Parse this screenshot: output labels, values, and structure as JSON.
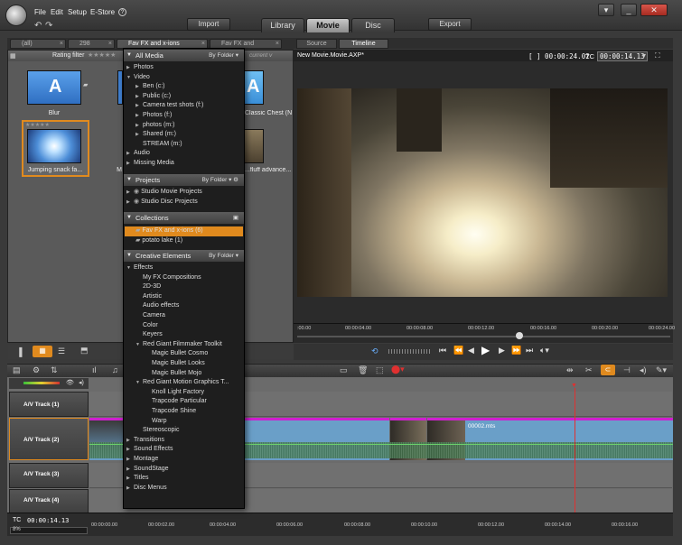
{
  "menu": {
    "file": "File",
    "edit": "Edit",
    "setup": "Setup",
    "estore": "E-Store",
    "help": "?"
  },
  "window": {
    "minimize": "_",
    "close": "✕",
    "menu": "▾"
  },
  "toolbar": {
    "import": "Import",
    "export": "Export"
  },
  "main_tabs": [
    {
      "label": "Library"
    },
    {
      "label": "Movie"
    },
    {
      "label": "Disc"
    }
  ],
  "library_tabs": [
    {
      "label": "(all)"
    },
    {
      "label": "298"
    },
    {
      "label": "Fav FX and x-ions"
    },
    {
      "label": "Fav FX and"
    }
  ],
  "library": {
    "rating_filter": "Rating filter",
    "sort_hint": "current v",
    "thumbs": [
      {
        "label": "Blur",
        "glyph": "A"
      },
      {
        "label": "Jumping snack fa...",
        "glyph": ""
      },
      {
        "label": "M",
        "glyph": ""
      },
      {
        "label": "Classic Chest (No ...",
        "glyph": "A"
      },
      {
        "label": "...fluff advance...",
        "glyph": ""
      }
    ]
  },
  "dropdown": {
    "all_media": {
      "title": "All Media",
      "sort": "By Folder"
    },
    "media_items": [
      {
        "label": "Photos",
        "arrow": "▶",
        "indent": 0
      },
      {
        "label": "Video",
        "arrow": "▼",
        "indent": 0
      },
      {
        "label": "Ben (c:)",
        "arrow": "▶",
        "indent": 1
      },
      {
        "label": "Public (c:)",
        "arrow": "▶",
        "indent": 1
      },
      {
        "label": "Camera test shots (f:)",
        "arrow": "▶",
        "indent": 1
      },
      {
        "label": "Photos (f:)",
        "arrow": "▶",
        "indent": 1
      },
      {
        "label": "photos (m:)",
        "arrow": "▶",
        "indent": 1
      },
      {
        "label": "Shared (m:)",
        "arrow": "▶",
        "indent": 1
      },
      {
        "label": "STREAM (m:)",
        "arrow": "",
        "indent": 1
      },
      {
        "label": "Audio",
        "arrow": "▶",
        "indent": 0
      },
      {
        "label": "Missing Media",
        "arrow": "▶",
        "indent": 0
      }
    ],
    "projects": {
      "title": "Projects",
      "sort": "By Folder"
    },
    "project_items": [
      {
        "label": "Studio Movie Projects",
        "arrow": "▶"
      },
      {
        "label": "Studio Disc Projects",
        "arrow": "▶"
      }
    ],
    "collections": {
      "title": "Collections"
    },
    "collection_items": [
      {
        "label": "Fav FX and x-ions  (6)"
      },
      {
        "label": "potato lake  (1)"
      }
    ],
    "creative": {
      "title": "Creative Elements",
      "sort": "By Folder"
    },
    "creative_items": [
      {
        "label": "Effects",
        "arrow": "▼",
        "indent": 0
      },
      {
        "label": "My FX Compositions",
        "arrow": "",
        "indent": 1
      },
      {
        "label": "2D-3D",
        "arrow": "",
        "indent": 1
      },
      {
        "label": "Artistic",
        "arrow": "",
        "indent": 1
      },
      {
        "label": "Audio effects",
        "arrow": "",
        "indent": 1
      },
      {
        "label": "Camera",
        "arrow": "",
        "indent": 1
      },
      {
        "label": "Color",
        "arrow": "",
        "indent": 1
      },
      {
        "label": "Keyers",
        "arrow": "",
        "indent": 1
      },
      {
        "label": "Red Giant Filmmaker Toolkit",
        "arrow": "▼",
        "indent": 1
      },
      {
        "label": "Magic Bullet Cosmo",
        "arrow": "",
        "indent": 2
      },
      {
        "label": "Magic Bullet Looks",
        "arrow": "",
        "indent": 2
      },
      {
        "label": "Magic Bullet Mojo",
        "arrow": "",
        "indent": 2
      },
      {
        "label": "Red Giant Motion Graphics T...",
        "arrow": "▼",
        "indent": 1
      },
      {
        "label": "Knoll Light Factory",
        "arrow": "",
        "indent": 2
      },
      {
        "label": "Trapcode Particular",
        "arrow": "",
        "indent": 2
      },
      {
        "label": "Trapcode Shine",
        "arrow": "",
        "indent": 2
      },
      {
        "label": "Warp",
        "arrow": "",
        "indent": 2
      },
      {
        "label": "Stereoscopic",
        "arrow": "",
        "indent": 1
      },
      {
        "label": "Transitions",
        "arrow": "▶",
        "indent": 0
      },
      {
        "label": "Sound Effects",
        "arrow": "▶",
        "indent": 0
      },
      {
        "label": "Montage",
        "arrow": "▶",
        "indent": 0
      },
      {
        "label": "SoundStage",
        "arrow": "▶",
        "indent": 0
      },
      {
        "label": "Titles",
        "arrow": "▶",
        "indent": 0
      },
      {
        "label": "Disc Menus",
        "arrow": "▶",
        "indent": 0
      }
    ]
  },
  "preview": {
    "tabs": [
      {
        "label": "Source"
      },
      {
        "label": "Timeline"
      }
    ],
    "title": "New Movie.Movie.AXP*",
    "duration": "[ ] 00:00:24.02",
    "tc_label": "TC",
    "timecode": "00:00:14.13",
    "ruler_ticks": [
      ":00.00",
      "00:00:04.00",
      "00:00:08.00",
      "00:00:12.00",
      "00:00:16.00",
      "00:00:20.00",
      "00:00:24.00"
    ]
  },
  "timeline": {
    "tracks": [
      {
        "label": "A/V Track (1)"
      },
      {
        "label": "A/V Track (2)"
      },
      {
        "label": "A/V Track (3)"
      },
      {
        "label": "A/V Track (4)"
      }
    ],
    "clip_label": "00002.mts",
    "tc_label": "TC",
    "timecode": "00:00:14.13",
    "zoom": "8%",
    "ruler_ticks": [
      "00:00:00.00",
      "00:00:02.00",
      "00:00:04.00",
      "00:00:06.00",
      "00:00:08.00",
      "00:00:10.00",
      "00:00:12.00",
      "00:00:14.00",
      "00:00:16.00"
    ]
  },
  "colors": {
    "accent": "#e08a1e",
    "clip": "#6a9fc8",
    "clip_border": "#d01fd0",
    "playhead": "#e03030"
  }
}
